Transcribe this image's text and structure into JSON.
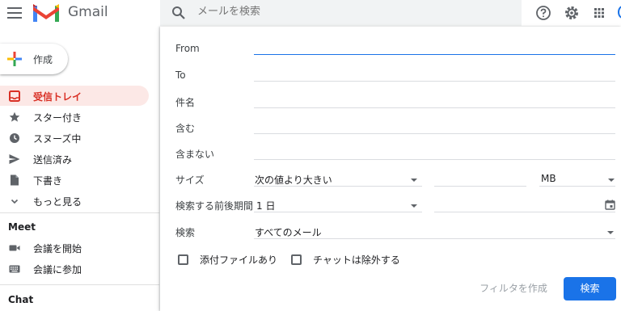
{
  "header": {
    "app_name": "Gmail",
    "search_placeholder": "メールを検索",
    "icons": [
      "menu-icon",
      "gmail-logo",
      "search-icon",
      "help-icon",
      "settings-icon",
      "apps-icon"
    ]
  },
  "sidebar": {
    "compose_label": "作成",
    "items": [
      {
        "label": "受信トレイ",
        "icon": "inbox-icon",
        "active": true
      },
      {
        "label": "スター付き",
        "icon": "star-icon"
      },
      {
        "label": "スヌーズ中",
        "icon": "clock-icon"
      },
      {
        "label": "送信済み",
        "icon": "send-icon"
      },
      {
        "label": "下書き",
        "icon": "draft-icon"
      },
      {
        "label": "もっと見る",
        "icon": "chevron-down-icon"
      }
    ],
    "meet": {
      "title": "Meet",
      "items": [
        {
          "label": "会議を開始",
          "icon": "video-icon"
        },
        {
          "label": "会議に参加",
          "icon": "keyboard-icon"
        }
      ]
    },
    "chat_title": "Chat"
  },
  "search_panel": {
    "from_label": "From",
    "to_label": "To",
    "subject_label": "件名",
    "has_words_label": "含む",
    "doesnt_have_label": "含まない",
    "size_label": "サイズ",
    "size_operator": "次の値より大きい",
    "size_unit": "MB",
    "date_label": "検索する前後期間",
    "date_range": "1 日",
    "search_in_label": "検索",
    "search_in_value": "すべてのメール",
    "has_attachment_label": "添付ファイルあり",
    "exclude_chats_label": "チャットは除外する",
    "create_filter_label": "フィルタを作成",
    "search_button_label": "検索"
  },
  "colors": {
    "accent": "#1a73e8",
    "active_nav_bg": "#fce8e6",
    "active_nav_text": "#d93025"
  }
}
